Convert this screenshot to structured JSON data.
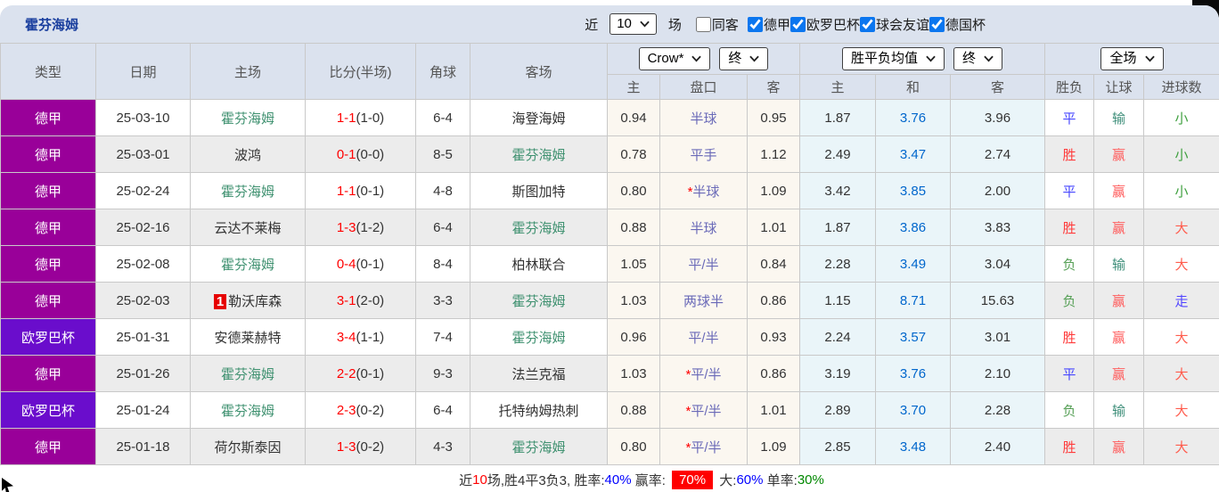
{
  "title": "霍芬海姆",
  "topbar": {
    "recent_label": "近",
    "recent_count": "10",
    "games_label": "场",
    "filters": [
      {
        "label": "同客",
        "checked": false
      },
      {
        "label": "德甲",
        "checked": true
      },
      {
        "label": "欧罗巴杯",
        "checked": true
      },
      {
        "label": "球会友谊",
        "checked": true
      },
      {
        "label": "德国杯",
        "checked": true
      }
    ]
  },
  "table": {
    "headers": {
      "type": "类型",
      "date": "日期",
      "home": "主场",
      "score": "比分(半场)",
      "corner": "角球",
      "away": "客场",
      "asia_sub": [
        "主",
        "盘口",
        "客"
      ],
      "europe_sub": [
        "主",
        "和",
        "客"
      ],
      "result_sub": [
        "胜负",
        "让球",
        "进球数"
      ]
    },
    "selects": {
      "bookmaker": "Crow*",
      "bookmaker_time": "终",
      "europe": "胜平负均值",
      "europe_time": "终",
      "scope": "全场"
    },
    "rows": [
      {
        "league": "德甲",
        "date": "25-03-10",
        "home": "霍芬海姆",
        "home_self": true,
        "home_rank": null,
        "score": "1-1",
        "half": "(1-0)",
        "corners": "6-4",
        "away": "海登海姆",
        "away_self": false,
        "ah_home": "0.94",
        "ah_star": false,
        "ah_line": "半球",
        "ah_away": "0.95",
        "odds_home": "1.87",
        "odds_draw": "3.76",
        "odds_away": "3.96",
        "result": "平",
        "handicap": "输",
        "goals": "小"
      },
      {
        "league": "德甲",
        "date": "25-03-01",
        "home": "波鸿",
        "home_self": false,
        "home_rank": null,
        "score": "0-1",
        "half": "(0-0)",
        "corners": "8-5",
        "away": "霍芬海姆",
        "away_self": true,
        "ah_home": "0.78",
        "ah_star": false,
        "ah_line": "平手",
        "ah_away": "1.12",
        "odds_home": "2.49",
        "odds_draw": "3.47",
        "odds_away": "2.74",
        "result": "胜",
        "handicap": "赢",
        "goals": "小"
      },
      {
        "league": "德甲",
        "date": "25-02-24",
        "home": "霍芬海姆",
        "home_self": true,
        "home_rank": null,
        "score": "1-1",
        "half": "(0-1)",
        "corners": "4-8",
        "away": "斯图加特",
        "away_self": false,
        "ah_home": "0.80",
        "ah_star": true,
        "ah_line": "半球",
        "ah_away": "1.09",
        "odds_home": "3.42",
        "odds_draw": "3.85",
        "odds_away": "2.00",
        "result": "平",
        "handicap": "赢",
        "goals": "小"
      },
      {
        "league": "德甲",
        "date": "25-02-16",
        "home": "云达不莱梅",
        "home_self": false,
        "home_rank": null,
        "score": "1-3",
        "half": "(1-2)",
        "corners": "6-4",
        "away": "霍芬海姆",
        "away_self": true,
        "ah_home": "0.88",
        "ah_star": false,
        "ah_line": "半球",
        "ah_away": "1.01",
        "odds_home": "1.87",
        "odds_draw": "3.86",
        "odds_away": "3.83",
        "result": "胜",
        "handicap": "赢",
        "goals": "大"
      },
      {
        "league": "德甲",
        "date": "25-02-08",
        "home": "霍芬海姆",
        "home_self": true,
        "home_rank": null,
        "score": "0-4",
        "half": "(0-1)",
        "corners": "8-4",
        "away": "柏林联合",
        "away_self": false,
        "ah_home": "1.05",
        "ah_star": false,
        "ah_line": "平/半",
        "ah_away": "0.84",
        "odds_home": "2.28",
        "odds_draw": "3.49",
        "odds_away": "3.04",
        "result": "负",
        "handicap": "输",
        "goals": "大"
      },
      {
        "league": "德甲",
        "date": "25-02-03",
        "home": "勒沃库森",
        "home_self": false,
        "home_rank": "1",
        "score": "3-1",
        "half": "(2-0)",
        "corners": "3-3",
        "away": "霍芬海姆",
        "away_self": true,
        "ah_home": "1.03",
        "ah_star": false,
        "ah_line": "两球半",
        "ah_away": "0.86",
        "odds_home": "1.15",
        "odds_draw": "8.71",
        "odds_away": "15.63",
        "result": "负",
        "handicap": "赢",
        "goals": "走"
      },
      {
        "league": "欧罗巴杯",
        "date": "25-01-31",
        "home": "安德莱赫特",
        "home_self": false,
        "home_rank": null,
        "score": "3-4",
        "half": "(1-1)",
        "corners": "7-4",
        "away": "霍芬海姆",
        "away_self": true,
        "ah_home": "0.96",
        "ah_star": false,
        "ah_line": "平/半",
        "ah_away": "0.93",
        "odds_home": "2.24",
        "odds_draw": "3.57",
        "odds_away": "3.01",
        "result": "胜",
        "handicap": "赢",
        "goals": "大"
      },
      {
        "league": "德甲",
        "date": "25-01-26",
        "home": "霍芬海姆",
        "home_self": true,
        "home_rank": null,
        "score": "2-2",
        "half": "(0-1)",
        "corners": "9-3",
        "away": "法兰克福",
        "away_self": false,
        "ah_home": "1.03",
        "ah_star": true,
        "ah_line": "平/半",
        "ah_away": "0.86",
        "odds_home": "3.19",
        "odds_draw": "3.76",
        "odds_away": "2.10",
        "result": "平",
        "handicap": "赢",
        "goals": "大"
      },
      {
        "league": "欧罗巴杯",
        "date": "25-01-24",
        "home": "霍芬海姆",
        "home_self": true,
        "home_rank": null,
        "score": "2-3",
        "half": "(0-2)",
        "corners": "6-4",
        "away": "托特纳姆热刺",
        "away_self": false,
        "ah_home": "0.88",
        "ah_star": true,
        "ah_line": "平/半",
        "ah_away": "1.01",
        "odds_home": "2.89",
        "odds_draw": "3.70",
        "odds_away": "2.28",
        "result": "负",
        "handicap": "输",
        "goals": "大"
      },
      {
        "league": "德甲",
        "date": "25-01-18",
        "home": "荷尔斯泰因",
        "home_self": false,
        "home_rank": null,
        "score": "1-3",
        "half": "(0-2)",
        "corners": "4-3",
        "away": "霍芬海姆",
        "away_self": true,
        "ah_home": "0.80",
        "ah_star": true,
        "ah_line": "平/半",
        "ah_away": "1.09",
        "odds_home": "2.85",
        "odds_draw": "3.48",
        "odds_away": "2.40",
        "result": "胜",
        "handicap": "赢",
        "goals": "大"
      }
    ]
  },
  "colors": {
    "league": {
      "德甲": "#990099",
      "欧罗巴杯": "#6a0dcc"
    },
    "outcome": {
      "胜": "#ff3b3b",
      "平": "#4747ff",
      "负": "#57a057"
    },
    "handicap": {
      "赢": "#ff5c5c",
      "输": "#3f8f7a"
    },
    "goals": {
      "大": "#ff5c4d",
      "小": "#3fa03f",
      "走": "#5246ff"
    },
    "self_team": "#3f9170",
    "score_red": "#ff0000",
    "draw_odds_blue": "#0066cc",
    "ah_line_text": "#6a6ab8",
    "star_red": "#ff0000"
  },
  "footer": {
    "segments": [
      {
        "text": "近",
        "color": "#333333"
      },
      {
        "text": "10",
        "color": "#ff0000"
      },
      {
        "text": "场,胜4平3负3, 胜率:",
        "color": "#333333"
      },
      {
        "text": "40%",
        "color": "#0000ff"
      },
      {
        "text": " 赢率: ",
        "color": "#333333"
      },
      {
        "text": "70%",
        "color": "#ffffff",
        "bg": "#ff0000"
      },
      {
        "text": " 大:",
        "color": "#333333"
      },
      {
        "text": "60%",
        "color": "#0000ff"
      },
      {
        "text": " 单率:",
        "color": "#333333"
      },
      {
        "text": "30%",
        "color": "#008800"
      }
    ]
  }
}
